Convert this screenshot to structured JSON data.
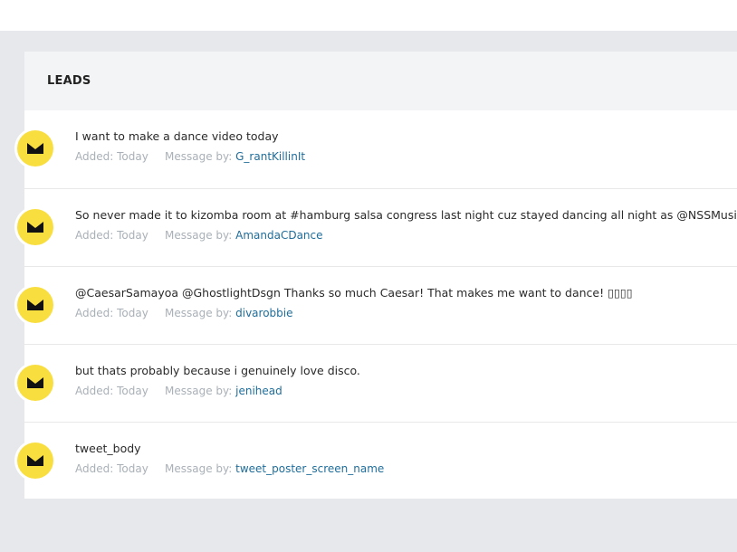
{
  "panel": {
    "title": "LEADS"
  },
  "labels": {
    "added": "Added: Today",
    "message_by": "Message by:"
  },
  "leads": [
    {
      "text": "I want to make a dance video today",
      "author": "G_rantKillinIt"
    },
    {
      "text": "So never made it to kizomba room at #hamburg salsa congress last night cuz stayed dancing all night as @NSSMusic was KI",
      "author": "AmandaCDance"
    },
    {
      "text": "@CaesarSamayoa @GhostlightDsgn Thanks so much Caesar! That makes me want to dance! ▯▯▯▯",
      "author": "divarobbie"
    },
    {
      "text": "but thats probably because i genuinely love disco.",
      "author": "jenihead"
    },
    {
      "text": "tweet_body",
      "author": "tweet_poster_screen_name"
    }
  ],
  "colors": {
    "avatar_bg": "#f9de3f",
    "link": "#1f6d9a",
    "meta": "#a9b0b7"
  },
  "icons": {
    "avatar": "crown-logo-icon"
  }
}
